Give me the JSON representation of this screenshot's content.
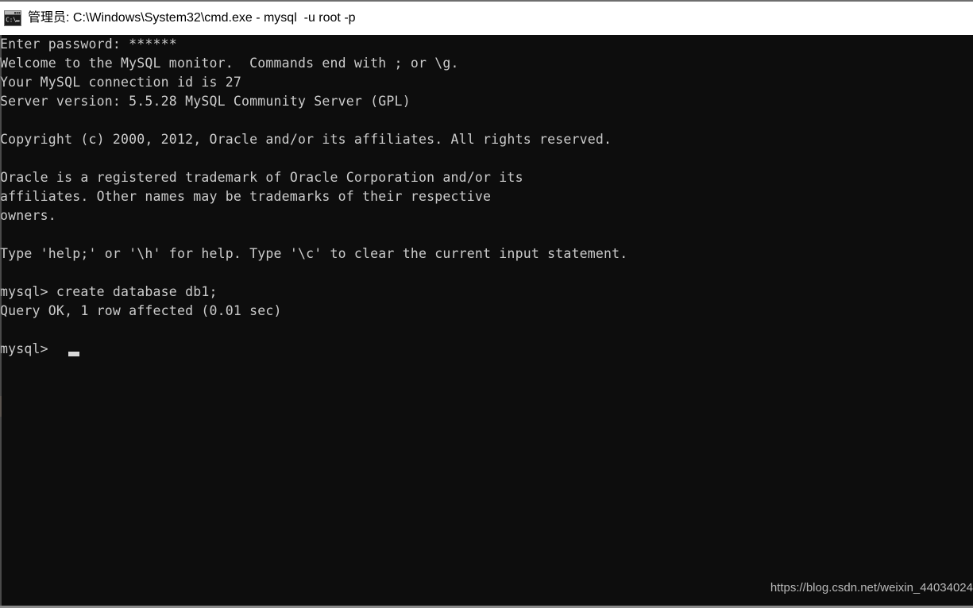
{
  "window": {
    "titlebar": {
      "icon": "cmd-console-icon",
      "title": "管理员: C:\\Windows\\System32\\cmd.exe - mysql  -u root -p"
    }
  },
  "terminal": {
    "background_color": "#0d0d0d",
    "text_color": "#cccccc",
    "lines": [
      "Enter password: ******",
      "Welcome to the MySQL monitor.  Commands end with ; or \\g.",
      "Your MySQL connection id is 27",
      "Server version: 5.5.28 MySQL Community Server (GPL)",
      "",
      "Copyright (c) 2000, 2012, Oracle and/or its affiliates. All rights reserved.",
      "",
      "Oracle is a registered trademark of Oracle Corporation and/or its",
      "affiliates. Other names may be trademarks of their respective",
      "owners.",
      "",
      "Type 'help;' or '\\h' for help. Type '\\c' to clear the current input statement.",
      "",
      "mysql> create database db1;",
      "Query OK, 1 row affected (0.01 sec)",
      ""
    ],
    "prompt": "mysql> ",
    "cursor": "text-cursor"
  },
  "watermark": {
    "text": "https://blog.csdn.net/weixin_44034024"
  }
}
